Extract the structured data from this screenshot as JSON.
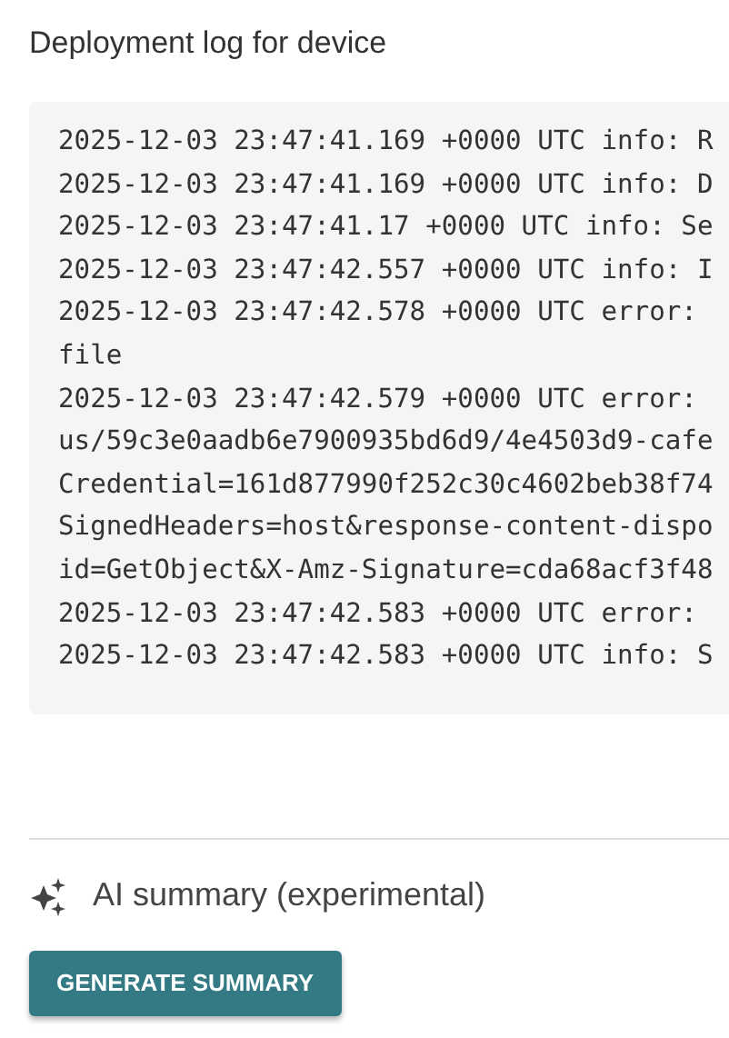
{
  "title": "Deployment log for device",
  "log_lines": [
    "2025-12-03 23:47:41.169 +0000 UTC info: R",
    "2025-12-03 23:47:41.169 +0000 UTC info: D",
    "2025-12-03 23:47:41.17 +0000 UTC info: Se",
    "2025-12-03 23:47:42.557 +0000 UTC info: I",
    "2025-12-03 23:47:42.578 +0000 UTC error:",
    "file",
    "2025-12-03 23:47:42.579 +0000 UTC error:",
    "us/59c3e0aadb6e7900935bd6d9/4e4503d9-cafe",
    "Credential=161d877990f252c30c4602beb38f74",
    "SignedHeaders=host&response-content-dispo",
    "id=GetObject&X-Amz-Signature=cda68acf3f48",
    "2025-12-03 23:47:42.583 +0000 UTC error:",
    "2025-12-03 23:47:42.583 +0000 UTC info: S"
  ],
  "summary": {
    "heading": "AI summary (experimental)",
    "button": "GENERATE SUMMARY"
  }
}
